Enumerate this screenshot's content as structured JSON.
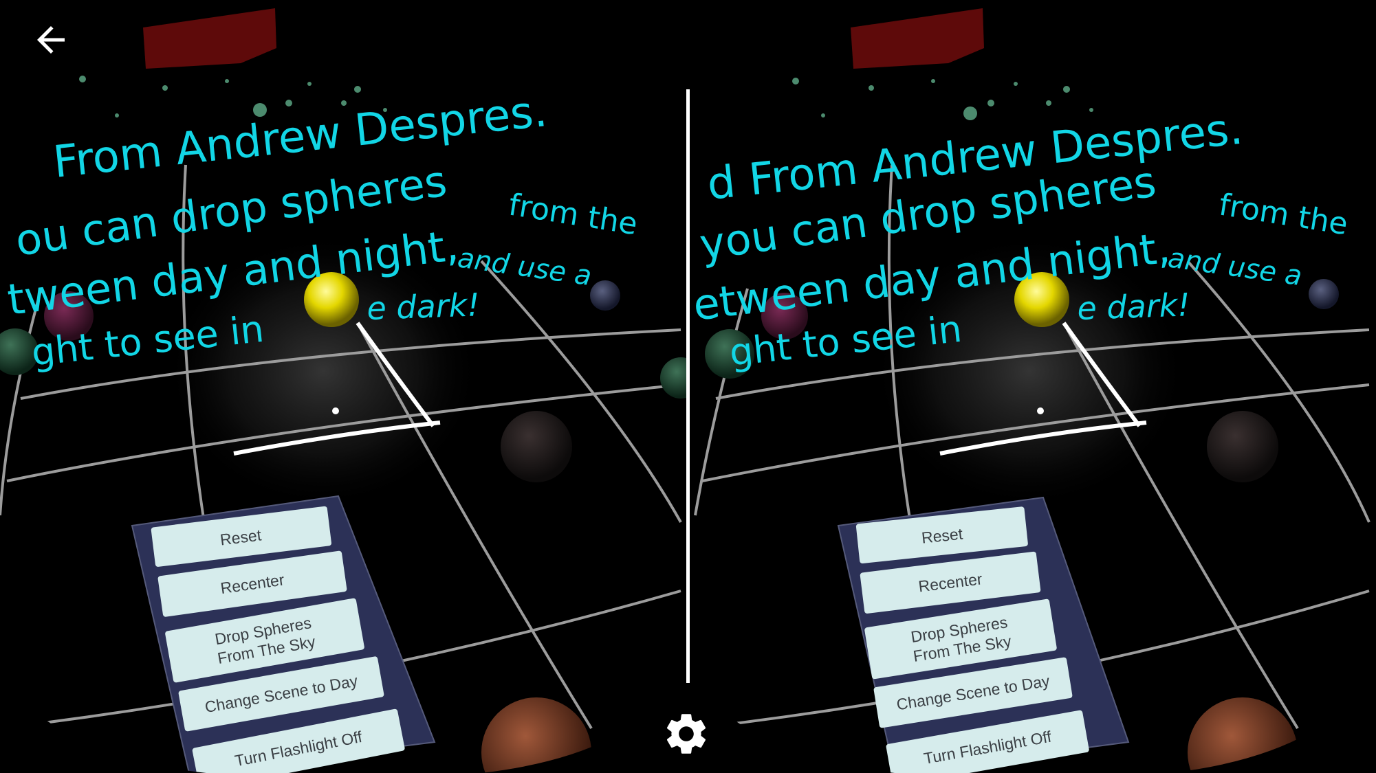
{
  "toolbar": {
    "back_icon": "arrow-back-icon",
    "settings_icon": "gear-icon"
  },
  "scene": {
    "text_lines": [
      "From Andrew Despres.",
      "you can drop spheres from the",
      "between day and night, and use a",
      "light to see in the dark!"
    ],
    "left_eye_visible": [
      [
        "From Andrew Despres."
      ],
      [
        "ou can drop spheres",
        "from the"
      ],
      [
        "tween day and night,",
        "and use a"
      ],
      [
        "ght to see in",
        "e dark!"
      ]
    ],
    "right_eye_visible": [
      [
        "d From Andrew Despres."
      ],
      [
        "you can drop spheres",
        "from the"
      ],
      [
        "etween day and night,",
        "and use a"
      ],
      [
        "ght to see in",
        "e dark!"
      ]
    ],
    "text_color": "#12d6e6"
  },
  "menu": {
    "buttons": [
      {
        "id": "reset",
        "lines": [
          "Reset"
        ]
      },
      {
        "id": "recenter",
        "lines": [
          "Recenter"
        ]
      },
      {
        "id": "drop-spheres",
        "lines": [
          "Drop Spheres",
          "From The Sky"
        ]
      },
      {
        "id": "change-scene",
        "lines": [
          "Change Scene to Day"
        ]
      },
      {
        "id": "flashlight",
        "lines": [
          "Turn Flashlight Off"
        ]
      }
    ],
    "panel_color": "#2c3157",
    "button_color": "#d6ecec"
  }
}
